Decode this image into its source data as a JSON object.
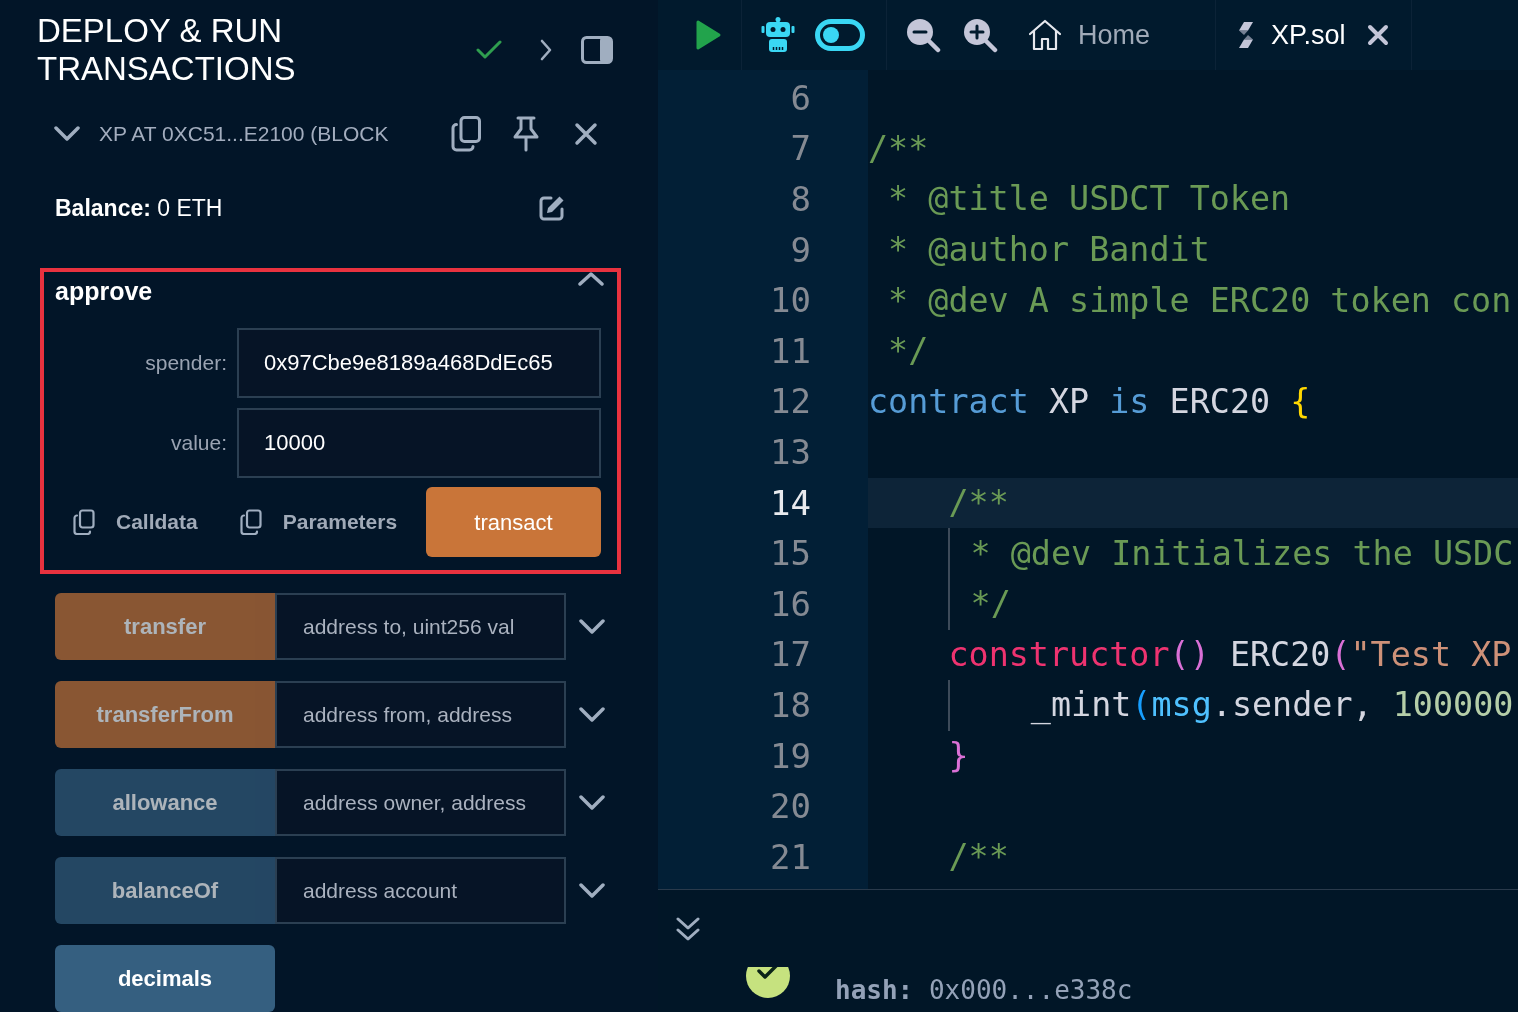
{
  "left_panel": {
    "title": "DEPLOY & RUN TRANSACTIONS",
    "instance": {
      "label": "XP AT 0XC51...E2100 (BLOCK",
      "expanded": true
    },
    "balance": "**Balance:** 0 ETH",
    "functions": [
      {
        "name": "approve",
        "kind": "transact",
        "disabled": false,
        "expanded": true,
        "highlighted": true,
        "params": [
          {
            "label": "spender:",
            "value": "0x97Cbe9e8189a468DdEc65"
          },
          {
            "label": "value:",
            "value": "10000"
          }
        ],
        "copy_buttons": [
          "Calldata",
          "Parameters"
        ],
        "submit": "transact"
      },
      {
        "name": "transfer",
        "kind": "transact",
        "disabled": true,
        "expanded": false,
        "highlighted": false,
        "placeholder": "address to, uint256 val"
      },
      {
        "name": "transferFrom",
        "kind": "transact",
        "disabled": true,
        "expanded": false,
        "highlighted": false,
        "placeholder": "address from, address"
      },
      {
        "name": "allowance",
        "kind": "call",
        "disabled": true,
        "expanded": false,
        "highlighted": false,
        "placeholder": "address owner, address"
      },
      {
        "name": "balanceOf",
        "kind": "call",
        "disabled": true,
        "expanded": false,
        "highlighted": false,
        "placeholder": "address account"
      },
      {
        "name": "decimals",
        "kind": "call",
        "disabled": false,
        "expanded": false,
        "highlighted": false
      }
    ]
  },
  "toolbar": {
    "tabs": [
      {
        "kind": "home",
        "label": "Home",
        "selected": false
      },
      {
        "kind": "file",
        "label": "XP.sol",
        "selected": true
      }
    ]
  },
  "editor": {
    "lines": [
      {
        "number": "6",
        "current": false
      },
      {
        "number": "7",
        "current": false,
        "tokens": [
          {
            "kind": "comment",
            "text": "/**"
          }
        ]
      },
      {
        "number": "8",
        "current": false,
        "tokens": [
          {
            "kind": "comment",
            "text": " * @title USDCT Token"
          }
        ]
      },
      {
        "number": "9",
        "current": false,
        "tokens": [
          {
            "kind": "comment",
            "text": " * @author Bandit"
          }
        ]
      },
      {
        "number": "10",
        "current": false,
        "tokens": [
          {
            "kind": "comment",
            "text": " * @dev A simple ERC20 token con"
          }
        ]
      },
      {
        "number": "11",
        "current": false,
        "tokens": [
          {
            "kind": "comment",
            "text": " */"
          }
        ]
      },
      {
        "number": "12",
        "current": false,
        "tokens": [
          {
            "kind": "keyword",
            "text": "contract"
          },
          {
            "kind": "text",
            "text": " XP "
          },
          {
            "kind": "keyword",
            "text": "is"
          },
          {
            "kind": "text",
            "text": " ERC20 "
          },
          {
            "kind": "bracket1",
            "text": "{"
          }
        ]
      },
      {
        "number": "13",
        "current": false
      },
      {
        "number": "14",
        "current": true,
        "tokens": [
          {
            "kind": "comment",
            "text": "    /**"
          }
        ]
      },
      {
        "number": "15",
        "current": false,
        "tokens": [
          {
            "kind": "comment",
            "text": "     * @dev Initializes the USDC"
          }
        ]
      },
      {
        "number": "16",
        "current": false,
        "tokens": [
          {
            "kind": "comment",
            "text": "     */"
          }
        ]
      },
      {
        "number": "17",
        "current": false,
        "tokens": [
          {
            "kind": "declaration",
            "text": "    constructor"
          },
          {
            "kind": "bracket2",
            "text": "()"
          },
          {
            "kind": "text",
            "text": " ERC20"
          },
          {
            "kind": "bracket2",
            "text": "("
          },
          {
            "kind": "string",
            "text": "\"Test XP"
          }
        ]
      },
      {
        "number": "18",
        "current": false,
        "tokens": [
          {
            "kind": "text",
            "text": "        _mint"
          },
          {
            "kind": "bracket3",
            "text": "("
          },
          {
            "kind": "global",
            "text": "msg"
          },
          {
            "kind": "text",
            "text": ".sender, "
          },
          {
            "kind": "number",
            "text": "100000"
          }
        ]
      },
      {
        "number": "19",
        "current": false,
        "tokens": [
          {
            "kind": "bracket2",
            "text": "    }"
          }
        ]
      },
      {
        "number": "20",
        "current": false
      },
      {
        "number": "21",
        "current": false,
        "tokens": [
          {
            "kind": "comment",
            "text": "    /**"
          }
        ]
      }
    ]
  },
  "terminal": {
    "log": "**hash:** 0x000...e338c"
  }
}
